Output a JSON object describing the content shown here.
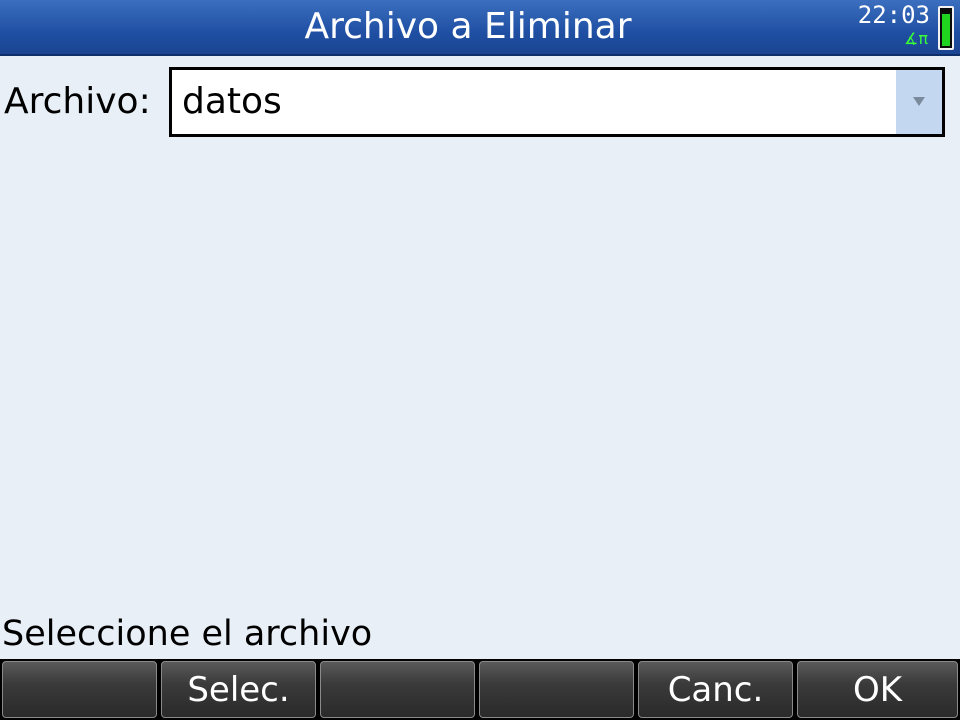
{
  "titlebar": {
    "title": "Archivo a Eliminar",
    "clock": "22:03",
    "status_indicators": "∡π",
    "battery_level": 0.9,
    "battery_icon": "battery-icon"
  },
  "form": {
    "label": "Archivo:",
    "value": "datos",
    "dropdown_icon": "chevron-down-icon"
  },
  "help_text": "Seleccione el archivo",
  "softkeys": [
    {
      "label": ""
    },
    {
      "label": "Selec."
    },
    {
      "label": ""
    },
    {
      "label": ""
    },
    {
      "label": "Canc."
    },
    {
      "label": "OK"
    }
  ],
  "colors": {
    "titlebar": "#1f4fa3",
    "background": "#e8eff6",
    "status_green": "#39ff39",
    "dropdown_button": "#c3d8f0"
  }
}
